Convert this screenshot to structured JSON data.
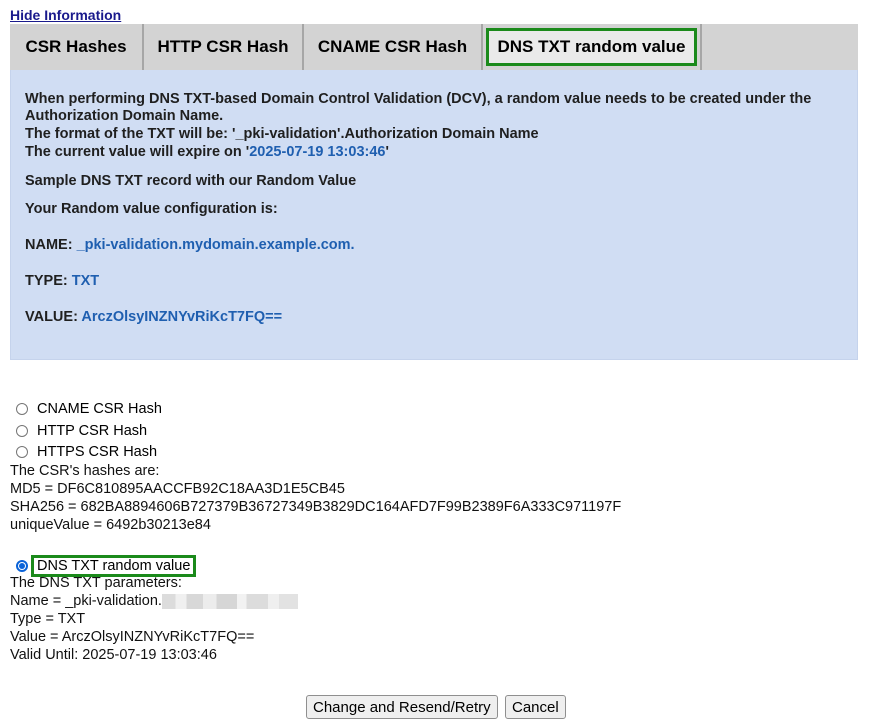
{
  "hide_link": "Hide Information",
  "tabs": [
    {
      "label": "CSR Hashes"
    },
    {
      "label": "HTTP CSR Hash"
    },
    {
      "label": "CNAME CSR Hash"
    },
    {
      "label": "DNS TXT random value",
      "active": true
    }
  ],
  "panel": {
    "intro_line1": "When performing DNS TXT-based Domain Control Validation (DCV), a random value needs to be created under the",
    "intro_line2": "Authorization Domain Name.",
    "format_line": "The format of the TXT will be: '_pki-validation'.Authorization Domain Name",
    "expire_prefix": "The current value will expire on '",
    "expire_value": "2025-07-19 13:03:46",
    "expire_suffix": "'",
    "sample_heading": "Sample DNS TXT record with our Random Value",
    "config_heading": "Your Random value configuration is:",
    "name_label": "NAME:",
    "name_value": "_pki-validation.mydomain.example.com.",
    "type_label": "TYPE:",
    "type_value": "TXT",
    "value_label": "VALUE:",
    "value_value": "ArczOlsyINZNYvRiKcT7FQ=="
  },
  "options": [
    {
      "label": "CNAME CSR Hash",
      "checked": false
    },
    {
      "label": "HTTP CSR Hash",
      "checked": false
    },
    {
      "label": "HTTPS CSR Hash",
      "checked": false
    }
  ],
  "hashes": {
    "heading": "The CSR's hashes are:",
    "md5": "MD5 = DF6C810895AACCFB92C18AA3D1E5CB45",
    "sha256": "SHA256 = 682BA8894606B727379B36727349B3829DC164AFD7F99B2389F6A333C971197F",
    "unique": "uniqueValue = 6492b30213e84"
  },
  "dns_option": {
    "label": "DNS TXT random value",
    "checked": true,
    "heading": "The DNS TXT parameters:",
    "name_prefix": "Name = _pki-validation.",
    "type": "Type = TXT",
    "value": "Value = ArczOlsyINZNYvRiKcT7FQ==",
    "valid_until": "Valid Until: 2025-07-19 13:03:46"
  },
  "buttons": {
    "resend": "Change and Resend/Retry",
    "cancel": "Cancel"
  },
  "colors": {
    "panel_bg": "#d0ddf3",
    "highlight_border": "#1b8a1b",
    "value_text": "#1f5fb0",
    "radio_checked": "#0b63d8"
  }
}
